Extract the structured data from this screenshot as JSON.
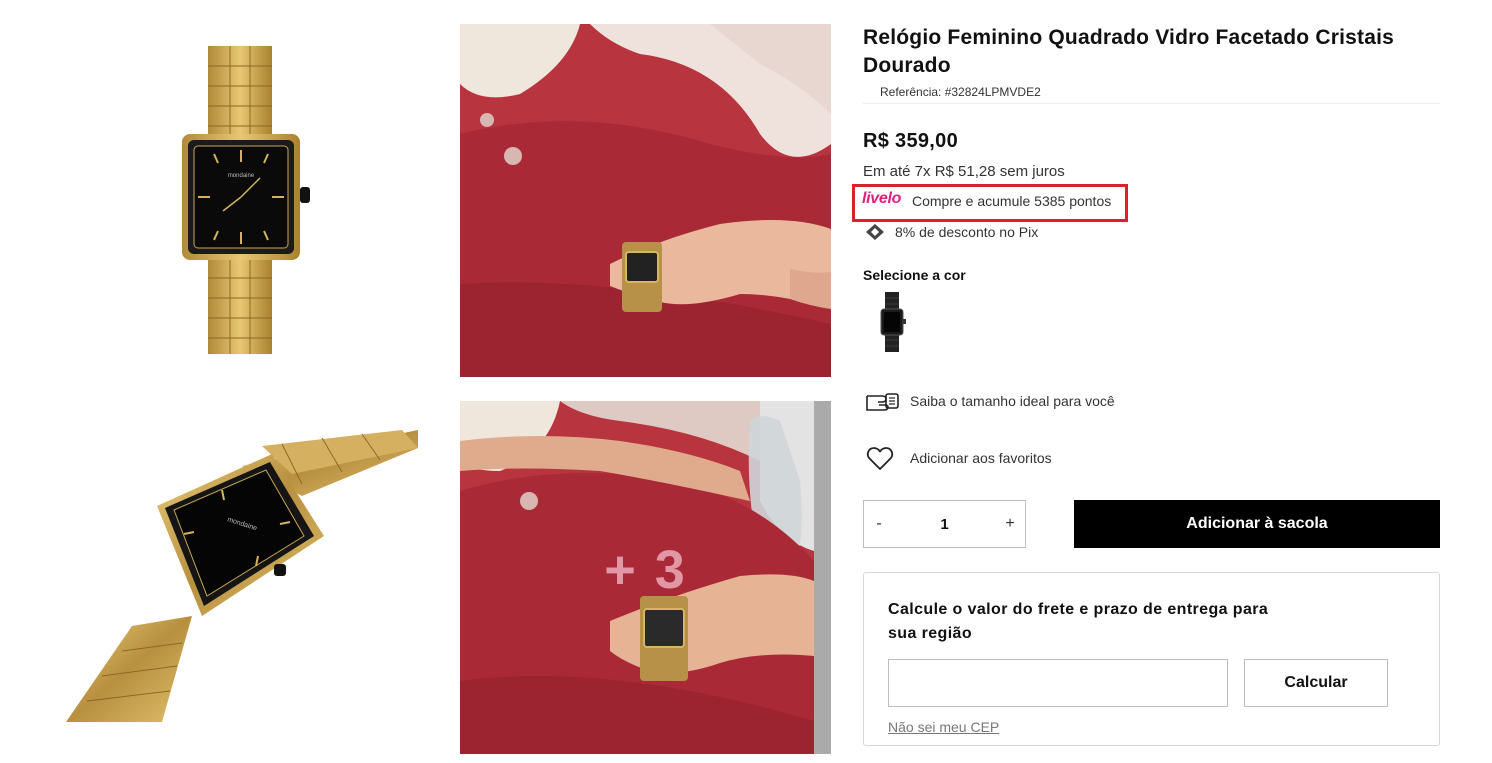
{
  "product": {
    "title": "Relógio Feminino Quadrado Vidro Facetado Cristais Dourado",
    "reference": "Referência: #32824LPMVDE2",
    "price": "R$ 359,00",
    "installments": "Em até 7x R$ 51,28 sem juros"
  },
  "livelo": {
    "logo": "livelo",
    "text": "Compre e acumule 5385 pontos",
    "highlight_color": "#d9222a",
    "logo_color": "#e0207e"
  },
  "pix": {
    "icon": "pix-icon",
    "text": "8% de desconto no Pix"
  },
  "color_selector": {
    "label": "Selecione a cor",
    "swatch_icon": "black-watch-swatch"
  },
  "size_guide": {
    "icon": "hand-measure-icon",
    "text": "Saiba o tamanho ideal para você"
  },
  "favorites": {
    "icon": "heart-icon",
    "text": "Adicionar aos favoritos"
  },
  "quantity": {
    "minus": "-",
    "value": "1",
    "plus": "+"
  },
  "cart": {
    "add_label": "Adicionar à sacola"
  },
  "freight": {
    "title": "Calcule o valor do frete e prazo de entrega para sua região",
    "input_value": "",
    "calculate_label": "Calcular",
    "unknown_cep_link": "Não sei meu CEP"
  },
  "gallery": {
    "more_photos_overlay": "+ 3",
    "images": [
      "watch-front-photo",
      "wrist-lifestyle-photo",
      "watch-angled-photo",
      "wrist-lifestyle-photo-2"
    ]
  },
  "watch_brand_text": "mondaine"
}
